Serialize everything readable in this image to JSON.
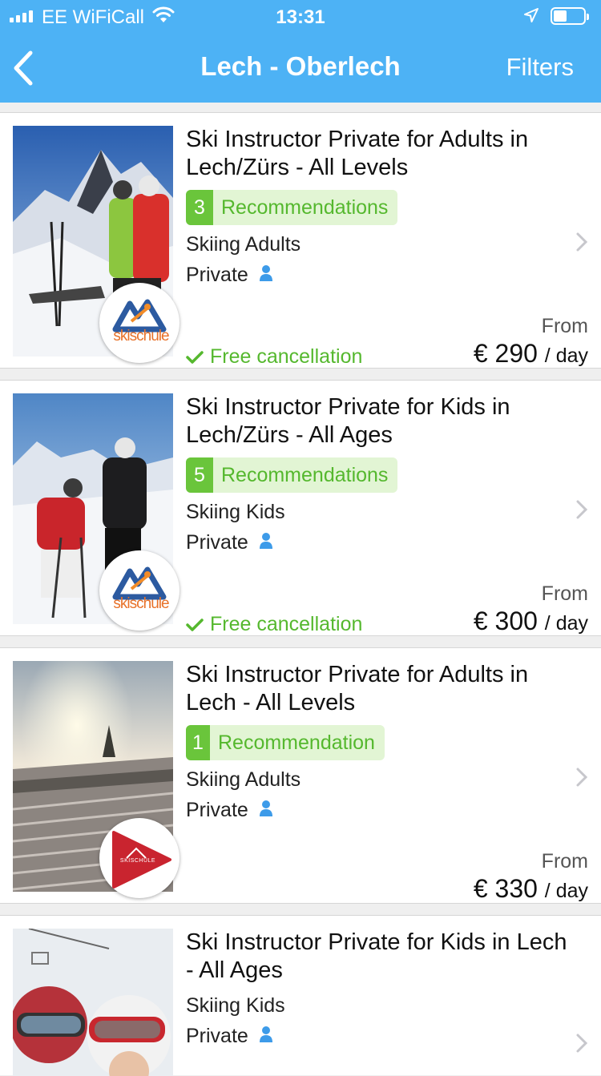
{
  "status_bar": {
    "carrier": "EE WiFiCall",
    "time": "13:31"
  },
  "nav": {
    "title": "Lech - Oberlech",
    "filters_label": "Filters"
  },
  "colors": {
    "accent": "#4db2f5",
    "green": "#6ac53b",
    "green_light": "#e2f5d4"
  },
  "listings": [
    {
      "title": "Ski Instructor Private for Adults in Lech/Zürs - All Levels",
      "rec_count": "3",
      "rec_label": "Recommendations",
      "category": "Skiing Adults",
      "type": "Private",
      "free_cancellation": "Free cancellation",
      "from_label": "From",
      "price": "€ 290",
      "unit": "/ day",
      "logo": "az-skischule-logo",
      "logo_text": "skischule"
    },
    {
      "title": "Ski Instructor Private for Kids in Lech/Zürs - All Ages",
      "rec_count": "5",
      "rec_label": "Recommendations",
      "category": "Skiing Kids",
      "type": "Private",
      "free_cancellation": "Free cancellation",
      "from_label": "From",
      "price": "€ 300",
      "unit": "/ day",
      "logo": "az-skischule-logo",
      "logo_text": "skischule"
    },
    {
      "title": "Ski Instructor Private for Adults in Lech - All Levels",
      "rec_count": "1",
      "rec_label": "Recommendation",
      "category": "Skiing Adults",
      "type": "Private",
      "from_label": "From",
      "price": "€ 330",
      "unit": "/ day",
      "logo": "skischule-red-triangle-logo",
      "logo_text": "SKISCHULE"
    },
    {
      "title": "Ski Instructor Private for Kids in Lech - All Ages",
      "category": "Skiing Kids",
      "type": "Private"
    }
  ]
}
